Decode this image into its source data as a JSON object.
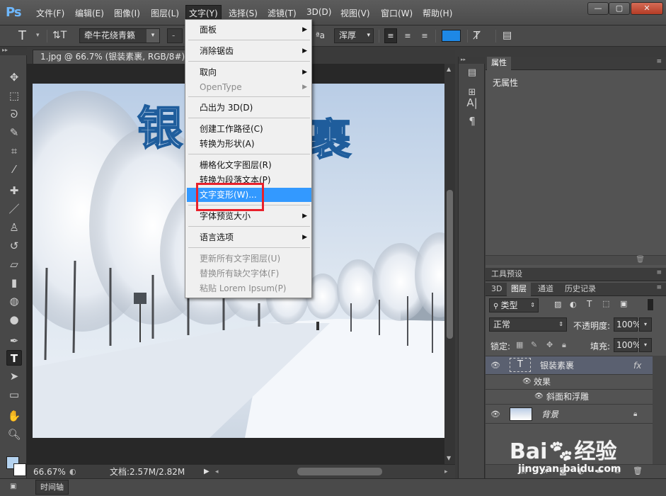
{
  "app": {
    "logo": "Ps"
  },
  "menubar": {
    "items": [
      "文件(F)",
      "编辑(E)",
      "图像(I)",
      "图层(L)",
      "文字(Y)",
      "选择(S)",
      "滤镜(T)",
      "3D(D)",
      "视图(V)",
      "窗口(W)",
      "帮助(H)"
    ],
    "active": "文字(Y)"
  },
  "options": {
    "font_family": "牵牛花绕青籁",
    "font_style": "-",
    "aa_label": "ªa",
    "aa_value": "浑厚",
    "color_swatch": "#1e88e5"
  },
  "document": {
    "tab_title": "1.jpg @ 66.7% (银装素裹, RGB/8#) *",
    "zoom": "66.67%",
    "doc_size": "文档:2.57M/2.82M",
    "canvas_text_left": "银",
    "canvas_text_right": "裹"
  },
  "timeline": {
    "label": "时间轴"
  },
  "dropdown": {
    "items": [
      {
        "label": "面板",
        "submenu": true,
        "enabled": true
      },
      {
        "label": "消除锯齿",
        "submenu": true,
        "enabled": true
      },
      {
        "label": "取向",
        "submenu": true,
        "enabled": true
      },
      {
        "label": "OpenType",
        "submenu": true,
        "enabled": false
      },
      {
        "label": "凸出为 3D(D)",
        "submenu": false,
        "enabled": true
      },
      {
        "label": "创建工作路径(C)",
        "submenu": false,
        "enabled": true
      },
      {
        "label": "转换为形状(A)",
        "submenu": false,
        "enabled": true
      },
      {
        "label": "栅格化文字图层(R)",
        "submenu": false,
        "enabled": true
      },
      {
        "label": "转换为段落文本(P)",
        "submenu": false,
        "enabled": true
      },
      {
        "label": "文字变形(W)...",
        "submenu": false,
        "enabled": true,
        "highlighted": true
      },
      {
        "label": "字体预览大小",
        "submenu": true,
        "enabled": true
      },
      {
        "label": "语言选项",
        "submenu": true,
        "enabled": true
      },
      {
        "label": "更新所有文字图层(U)",
        "submenu": false,
        "enabled": false
      },
      {
        "label": "替换所有缺欠字体(F)",
        "submenu": false,
        "enabled": false
      },
      {
        "label": "粘贴 Lorem Ipsum(P)",
        "submenu": false,
        "enabled": false
      }
    ]
  },
  "properties": {
    "tab": "属性",
    "content": "无属性"
  },
  "tool_presets": {
    "tab": "工具预设"
  },
  "layers_panel": {
    "tabs": [
      "3D",
      "图层",
      "通道",
      "历史记录"
    ],
    "active_tab": "图层",
    "filter": "类型",
    "blend_mode": "正常",
    "opacity_label": "不透明度:",
    "opacity": "100%",
    "lock_label": "锁定:",
    "fill_label": "填充:",
    "fill": "100%",
    "layers": [
      {
        "name": "银装素裹",
        "type": "text",
        "fx": "fx",
        "effects_label": "效果",
        "effect": "斜面和浮雕"
      },
      {
        "name": "背景",
        "type": "image"
      }
    ]
  },
  "watermark": {
    "brand": "Bai",
    "brand2": "经验",
    "url": "jingyan.baidu.com"
  }
}
